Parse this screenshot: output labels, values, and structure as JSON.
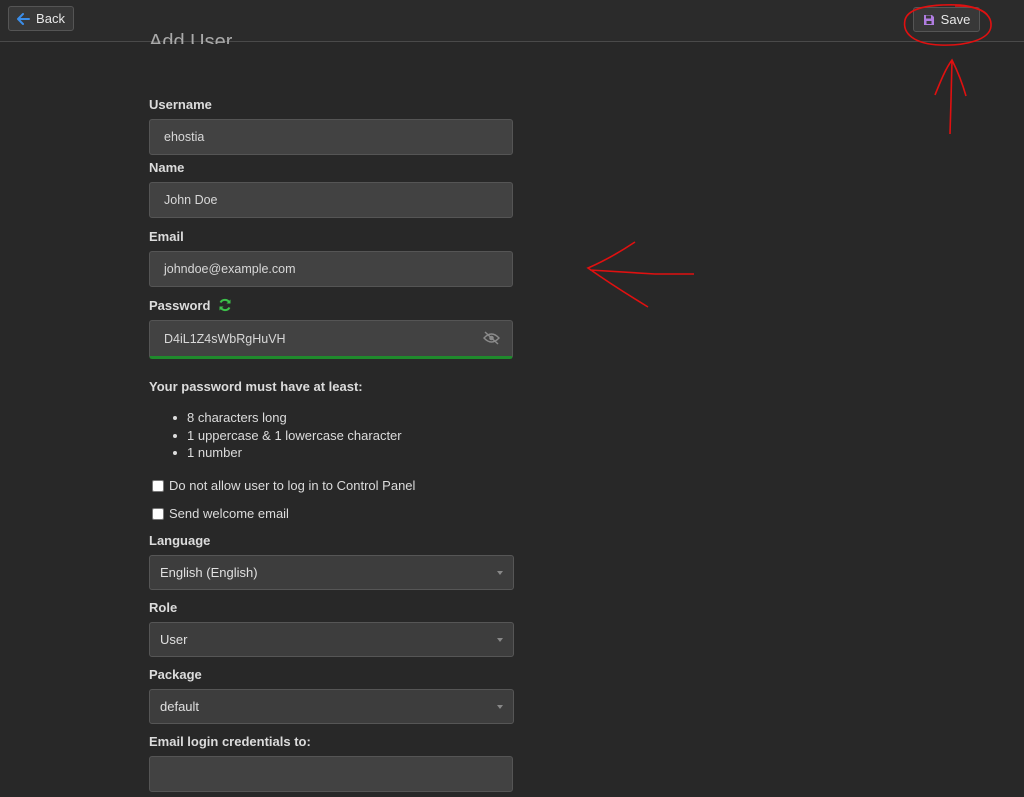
{
  "topbar": {
    "back_label": "Back",
    "save_label": "Save"
  },
  "page": {
    "title": "Add User"
  },
  "form": {
    "username": {
      "label": "Username",
      "value": "ehostia"
    },
    "name": {
      "label": "Name",
      "value": "John Doe"
    },
    "email": {
      "label": "Email",
      "value": "johndoe@example.com"
    },
    "password": {
      "label": "Password",
      "value": "D4iL1Z4sWbRgHuVH"
    },
    "password_rules": {
      "title": "Your password must have at least:",
      "items": [
        "8 characters long",
        "1 uppercase & 1 lowercase character",
        "1 number"
      ]
    },
    "no_login_label": "Do not allow user to log in to Control Panel",
    "welcome_email_label": "Send welcome email",
    "language": {
      "label": "Language",
      "value": "English (English)"
    },
    "role": {
      "label": "Role",
      "value": "User"
    },
    "package": {
      "label": "Package",
      "value": "default"
    },
    "email_credentials": {
      "label": "Email login credentials to:",
      "value": ""
    }
  },
  "colors": {
    "accent_blue": "#3b8eea",
    "save_icon": "#b07de0",
    "refresh_green": "#3cc14a",
    "strength_bar": "#1f8a2c",
    "annotation_red": "#e01010"
  }
}
